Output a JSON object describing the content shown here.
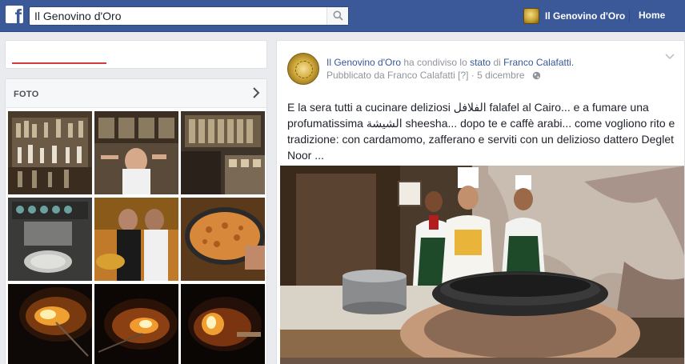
{
  "topbar": {
    "logo_letter": "f",
    "search_value": "Il Genovino d'Oro",
    "profile_name": "Il Genovino d'Oro",
    "home_label": "Home"
  },
  "photos": {
    "title": "FOTO"
  },
  "post": {
    "author": "Il Genovino d'Oro",
    "shared_text_pre": "ha condiviso lo",
    "shared_link": "stato",
    "shared_text_mid": "di",
    "friend": "Franco Calafatti",
    "published_prefix": "Pubblicato da Franco Calafatti",
    "published_marker": "[?]",
    "date_sep": "·",
    "date": "5 dicembre",
    "body": "E la sera tutti a cucinare deliziosi الفلافل falafel al Cairo... e a fumare una profumatissima الشيشة sheesha... dopo te e caffè arabi... come vogliono rito e tradizione: con cardamomo, zafferano e serviti con un delizioso dattero Deglet Noor ..."
  },
  "colors": {
    "brand": "#3b5998",
    "link": "#365899",
    "meta": "#90949c"
  }
}
